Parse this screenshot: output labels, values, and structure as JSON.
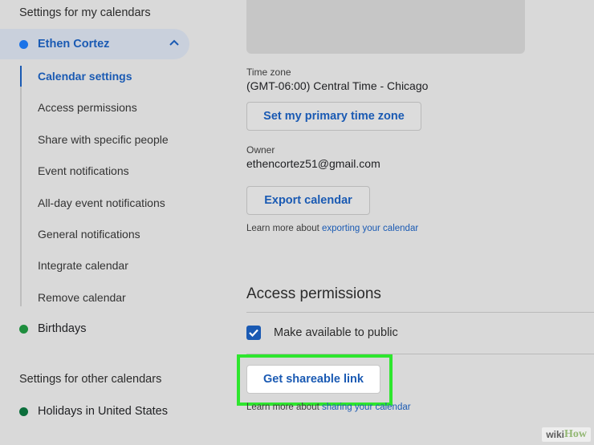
{
  "sidebar": {
    "my_calendars_title": "Settings for my calendars",
    "active_calendar": {
      "name": "Ethen Cortez",
      "dot_color": "#1a73e8"
    },
    "subnav": [
      "Calendar settings",
      "Access permissions",
      "Share with specific people",
      "Event notifications",
      "All-day event notifications",
      "General notifications",
      "Integrate calendar",
      "Remove calendar"
    ],
    "birthdays": {
      "name": "Birthdays",
      "dot_color": "#1e8e3e"
    },
    "other_calendars_title": "Settings for other calendars",
    "holidays": {
      "name": "Holidays in United States",
      "dot_color": "#0b6e3b"
    }
  },
  "main": {
    "time_zone_label": "Time zone",
    "time_zone_value": "(GMT-06:00) Central Time - Chicago",
    "set_primary_tz_button": "Set my primary time zone",
    "owner_label": "Owner",
    "owner_value": "ethencortez51@gmail.com",
    "export_button": "Export calendar",
    "export_learn_prefix": "Learn more about ",
    "export_learn_link": "exporting your calendar",
    "access_heading": "Access permissions",
    "public_checkbox_label": "Make available to public",
    "public_checked": true,
    "shareable_link_button": "Get shareable link",
    "share_learn_prefix": "Learn more about ",
    "share_learn_link": "sharing your calendar"
  },
  "colors": {
    "accent": "#1a5ab3",
    "highlight": "#2ee62e"
  },
  "watermark": {
    "part1": "wiki",
    "part2": "How"
  }
}
